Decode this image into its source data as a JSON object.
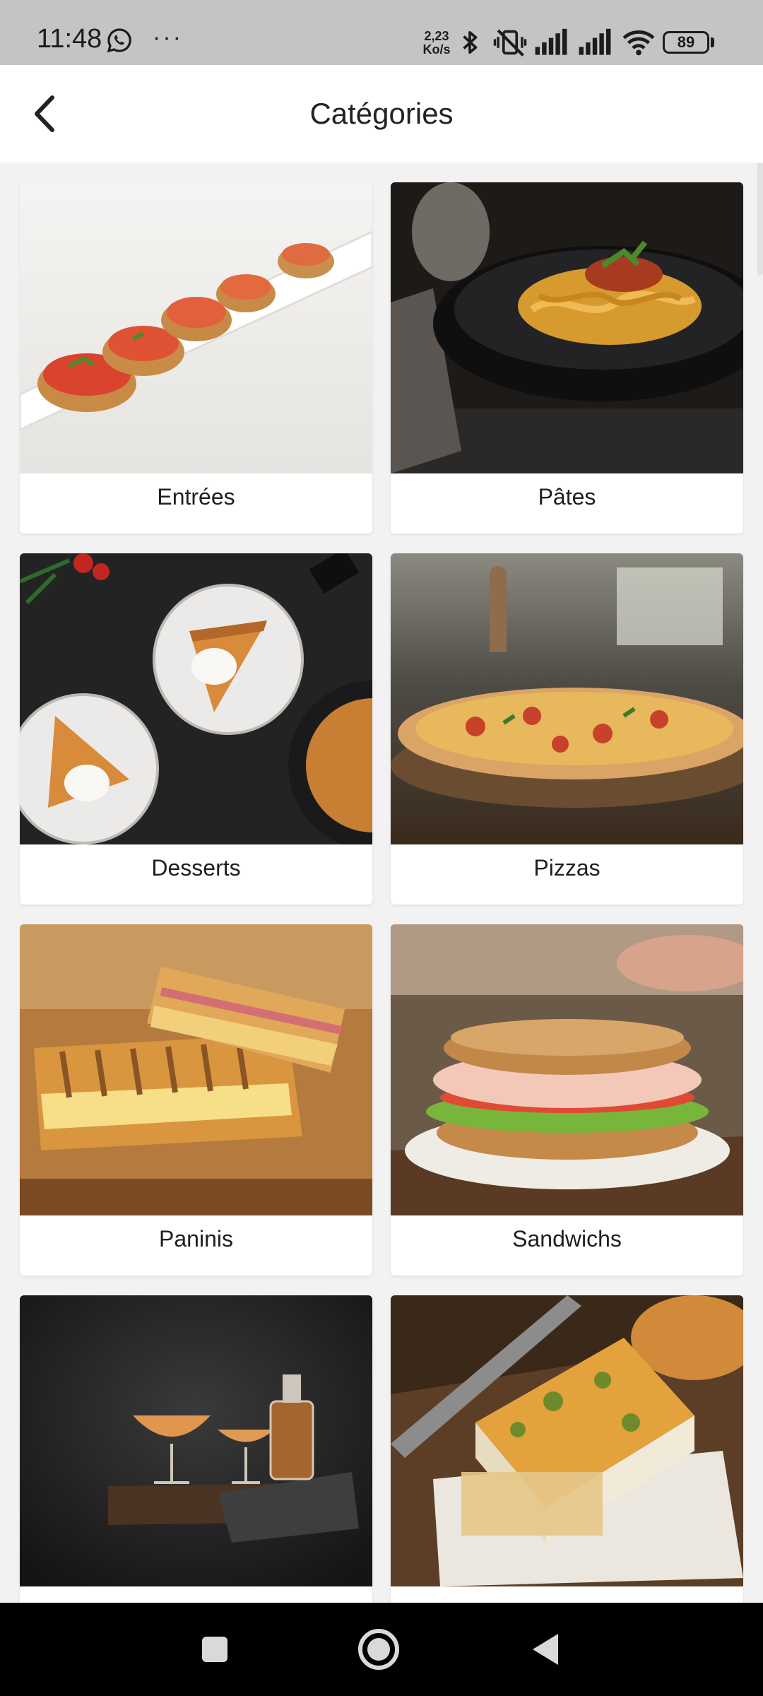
{
  "status_bar": {
    "time": "11:48",
    "more": "···",
    "speed_value": "2,23",
    "speed_unit": "Ko/s",
    "battery": "89",
    "icons": [
      "whatsapp-icon",
      "bluetooth-icon",
      "vibrate-off-icon",
      "signal-icon",
      "signal-icon",
      "wifi-icon",
      "battery-icon"
    ]
  },
  "app_bar": {
    "title": "Catégories",
    "back_icon": "chevron-left-icon"
  },
  "categories": [
    {
      "label": "Entrées"
    },
    {
      "label": "Pâtes"
    },
    {
      "label": "Desserts"
    },
    {
      "label": "Pizzas"
    },
    {
      "label": "Paninis"
    },
    {
      "label": "Sandwichs"
    },
    {
      "label": ""
    },
    {
      "label": ""
    }
  ],
  "nav_bar": {
    "icons": [
      "recents-square-icon",
      "home-circle-icon",
      "back-triangle-icon"
    ]
  },
  "colors": {
    "status_bar_bg": "#c4c4c4",
    "app_bar_bg": "#ffffff",
    "page_bg": "#f2f2f2",
    "nav_bar_bg": "#000000"
  }
}
